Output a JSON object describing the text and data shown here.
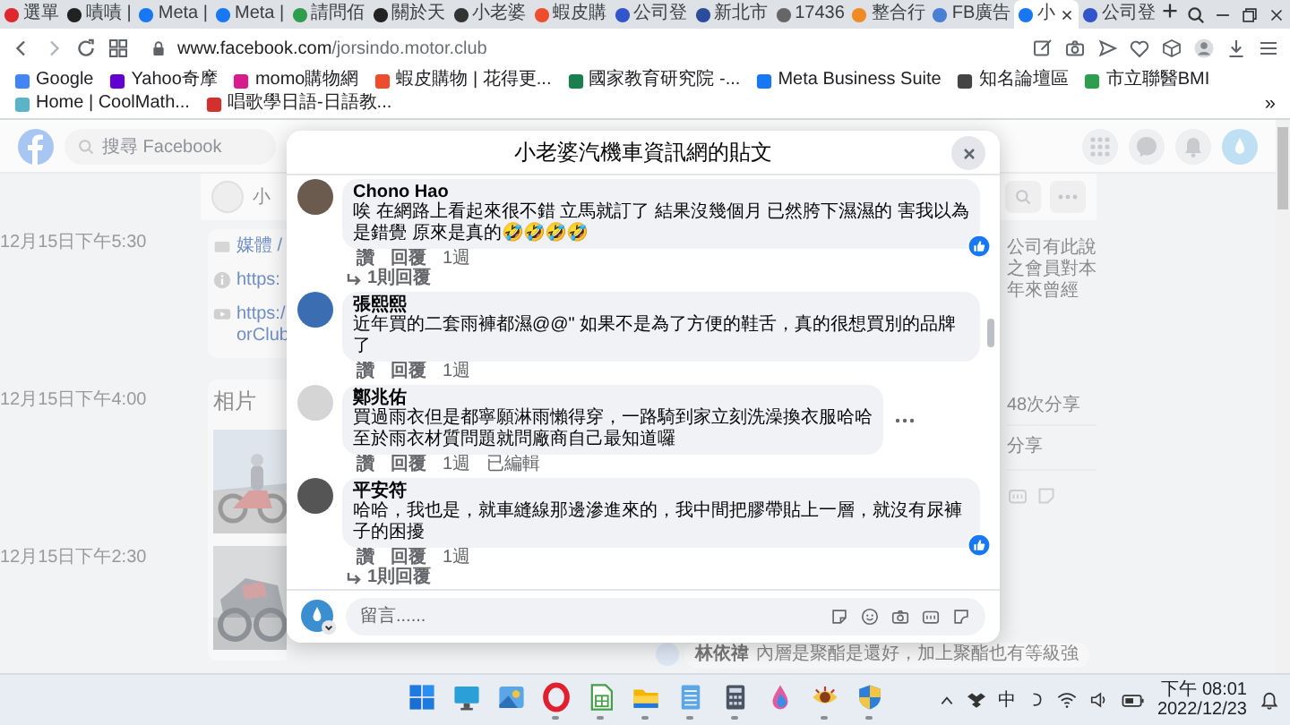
{
  "browser": {
    "tabs": [
      {
        "label": "選單",
        "selected": false
      },
      {
        "label": "嘖嘖 |",
        "selected": false
      },
      {
        "label": "Meta |",
        "selected": false
      },
      {
        "label": "Meta |",
        "selected": false
      },
      {
        "label": "請問佰",
        "selected": false
      },
      {
        "label": "關於天",
        "selected": false
      },
      {
        "label": "小老婆",
        "selected": false
      },
      {
        "label": "蝦皮購",
        "selected": false
      },
      {
        "label": "公司登",
        "selected": false
      },
      {
        "label": "新北市",
        "selected": false
      },
      {
        "label": "17436",
        "selected": false
      },
      {
        "label": "整合行",
        "selected": false
      },
      {
        "label": "FB廣告",
        "selected": false
      },
      {
        "label": "小",
        "selected": true
      },
      {
        "label": "公司登",
        "selected": false
      }
    ],
    "url": {
      "host": "www.facebook.com",
      "path": "/jorsindo.motor.club"
    },
    "bookmarks": [
      "Google",
      "Yahoo奇摩",
      "momo購物網",
      "蝦皮購物 | 花得更...",
      "國家教育研究院 -...",
      "Meta Business Suite",
      "知名論壇區",
      "市立聯醫BMI",
      "Home | CoolMath...",
      "唱歌學日語-日語教..."
    ],
    "bookmarks_more": "»"
  },
  "page": {
    "search_placeholder": "搜尋 Facebook",
    "page_name": "小",
    "about_links": [
      {
        "kind": "media",
        "lines": [
          "媒體 /"
        ]
      },
      {
        "kind": "info",
        "lines": [
          "https:"
        ]
      },
      {
        "kind": "video",
        "lines": [
          "https:/",
          "orClub"
        ]
      }
    ],
    "photos_title": "相片",
    "photos": [
      {
        "kind": "picture"
      },
      {
        "kind": "picture"
      }
    ],
    "timestamps": [
      "12月15日下午5:30",
      "12月15日下午4:00",
      "12月15日下午2:30"
    ],
    "post_lines": [
      "公司有此說",
      "之會員對本",
      "年來曾經"
    ],
    "share_count": "48次分享",
    "share_button": "分享",
    "comment": {
      "author": "林依禕",
      "text": "內層是聚酯是還好，加上聚酯也有等級強"
    }
  },
  "dialog": {
    "title": "小老婆汽機車資訊網的貼文",
    "comments": [
      {
        "author": "Chono Hao",
        "lines": [
          "唉 在網路上看起來很不錯 立馬就訂了 結果沒幾個月 已然胯下濕濕的 害我以為是錯覺 原來是真的🤣🤣🤣🤣"
        ],
        "like": "讚",
        "reply": "回覆",
        "time": "1週",
        "has_reaction": true,
        "show_more": false,
        "replies": "1則回覆"
      },
      {
        "author": "張熙熙",
        "lines": [
          "近年買的二套雨褲都濕@@\" 如果不是為了方便的鞋舌，真的很想買別的品牌了"
        ],
        "like": "讚",
        "reply": "回覆",
        "time": "1週",
        "has_reaction": false,
        "show_more": false
      },
      {
        "author": "鄭兆佑",
        "lines": [
          "買過雨衣但是都寧願淋雨懶得穿，一路騎到家立刻洗澡換衣服哈哈",
          "至於雨衣材質問題就問廠商自己最知道囉"
        ],
        "like": "讚",
        "reply": "回覆",
        "time": "1週",
        "edited": "已編輯",
        "has_reaction": false,
        "show_more": true
      },
      {
        "author": "平安符",
        "lines": [
          "哈哈，我也是，就車縫線那邊滲進來的，我中間把膠帶貼上一層，就沒有尿褲子的困擾"
        ],
        "like": "讚",
        "reply": "回覆",
        "time": "1週",
        "has_reaction": true,
        "show_more": false,
        "replies": "1則回覆"
      }
    ],
    "composer": {
      "placeholder": "留言......"
    }
  },
  "taskbar": {
    "apps": [
      {
        "kind": "start",
        "running": false
      },
      {
        "kind": "monitor",
        "running": false
      },
      {
        "kind": "photos",
        "running": false
      },
      {
        "kind": "ring",
        "running": true
      },
      {
        "kind": "sheet",
        "running": true
      },
      {
        "kind": "folder",
        "running": true
      },
      {
        "kind": "notepad",
        "running": true
      },
      {
        "kind": "calculator",
        "running": true
      },
      {
        "kind": "droplet",
        "running": false
      },
      {
        "kind": "eye",
        "running": true
      },
      {
        "kind": "shield",
        "running": true
      }
    ],
    "ime": "中",
    "time": "下午 08:01",
    "date": "2022/12/23"
  }
}
